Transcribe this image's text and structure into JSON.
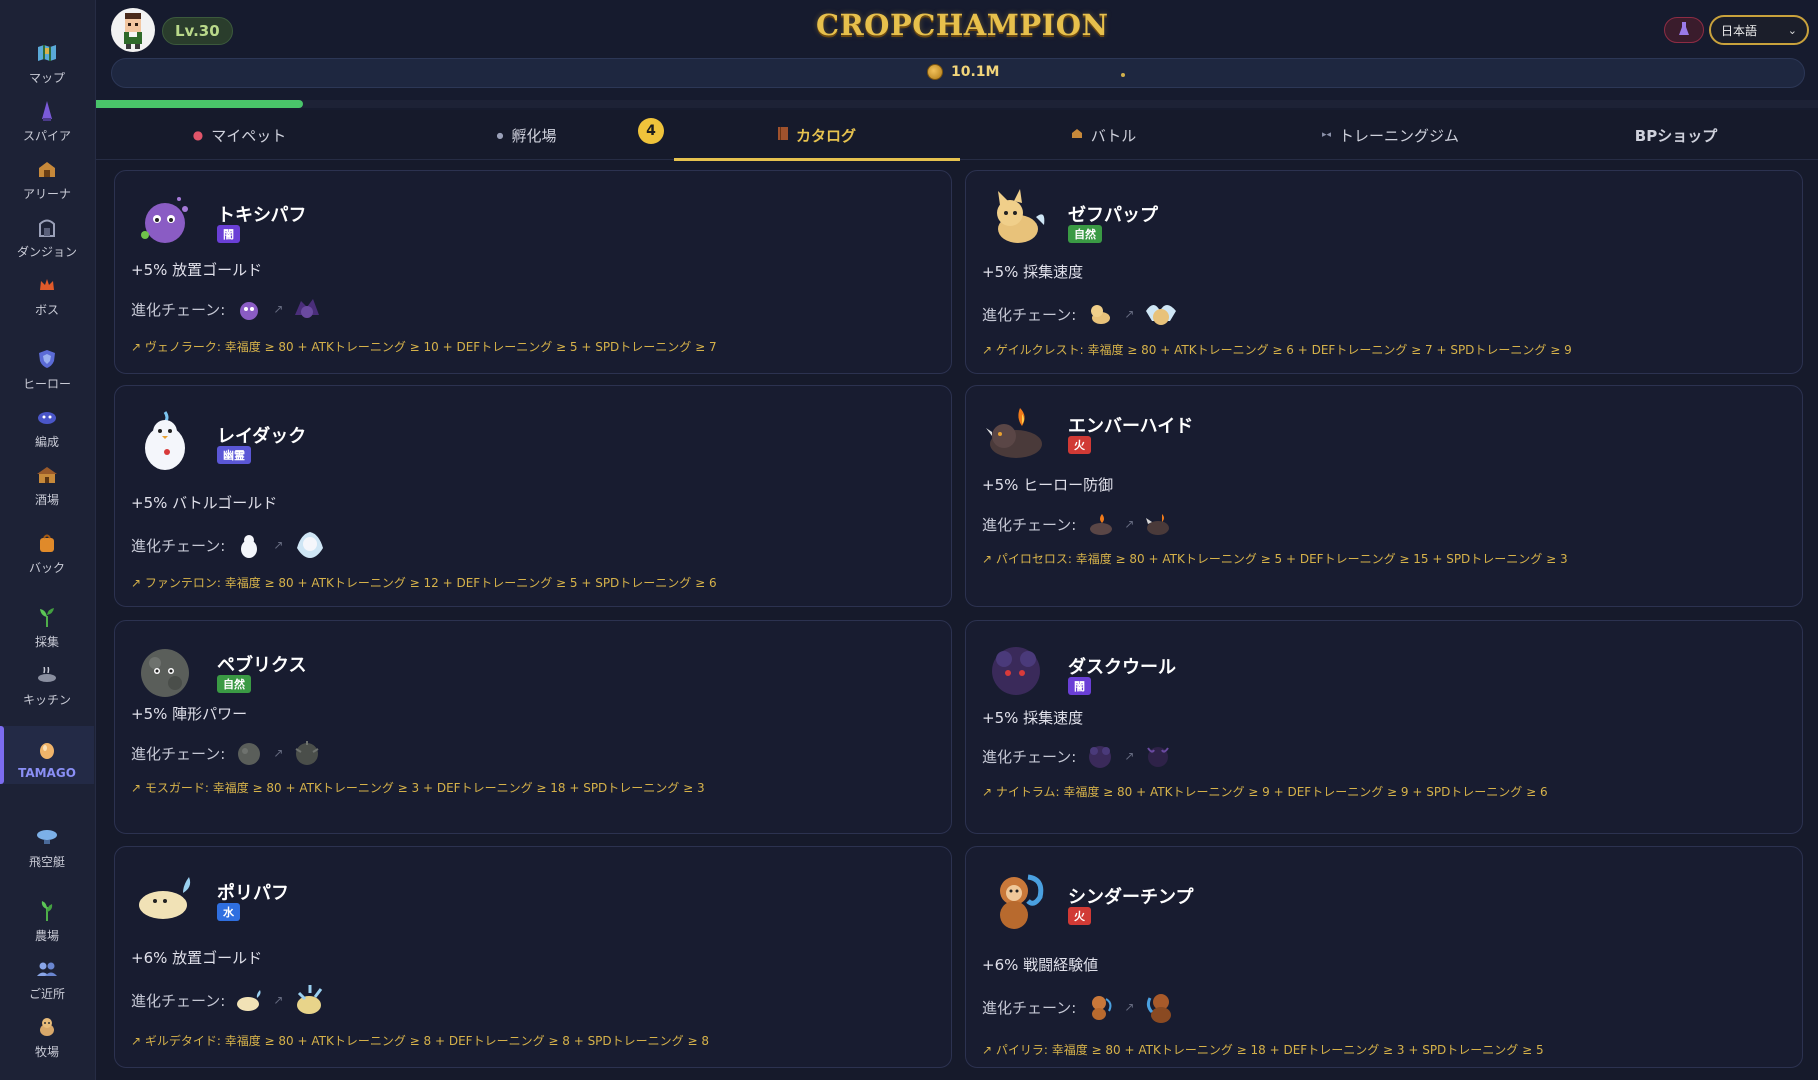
{
  "sidebar": {
    "items": [
      {
        "label": "マップ",
        "icon": "map-icon"
      },
      {
        "label": "スパイア",
        "icon": "spire-icon"
      },
      {
        "label": "アリーナ",
        "icon": "arena-icon"
      },
      {
        "label": "ダンジョン",
        "icon": "dungeon-icon"
      },
      {
        "label": "ボス",
        "icon": "boss-icon"
      },
      {
        "label": "ヒーロー",
        "icon": "hero-icon"
      },
      {
        "label": "編成",
        "icon": "formation-icon"
      },
      {
        "label": "酒場",
        "icon": "tavern-icon"
      },
      {
        "label": "バック",
        "icon": "bag-icon"
      },
      {
        "label": "採集",
        "icon": "sprout-icon"
      },
      {
        "label": "キッチン",
        "icon": "kitchen-icon"
      },
      {
        "label": "TAMAGO",
        "icon": "egg-icon"
      },
      {
        "label": "飛空艇",
        "icon": "airship-icon"
      },
      {
        "label": "農場",
        "icon": "farm-icon"
      },
      {
        "label": "ご近所",
        "icon": "neighbors-icon"
      },
      {
        "label": "牧場",
        "icon": "ranch-icon"
      }
    ],
    "active_label": "TAMAGO"
  },
  "header": {
    "level": "Lv.30",
    "logo": "CROPCHAMPION",
    "gold": "10.1M",
    "language": "日本語",
    "xp_progress_percent": 12
  },
  "tabs": {
    "items": [
      {
        "label": "マイペット",
        "icon": "paw-icon"
      },
      {
        "label": "孵化場",
        "icon": "egg-small-icon"
      },
      {
        "label": "カタログ",
        "icon": "book-icon"
      },
      {
        "label": "バトル",
        "icon": "arena-small-icon"
      },
      {
        "label": "トレーニングジム",
        "icon": "dumbbell-icon"
      },
      {
        "label": "BPショップ",
        "icon": ""
      }
    ],
    "active": "カタログ",
    "hatchery_badge": "4"
  },
  "labels": {
    "chain": "進化チェーン:"
  },
  "colors": {
    "gold_accent": "#e6c24f",
    "dark": "#6a3fd6",
    "nature": "#3a9a44",
    "ghost": "#5b57d6",
    "fire": "#d13a35",
    "water": "#2f6fe0"
  },
  "pets": [
    {
      "name": "トキシパフ",
      "element": "闇",
      "element_type": "dark",
      "bonus": "+5% 放置ゴールド",
      "requirement": "↗ ヴェノラーク: 幸福度 ≥ 80 + ATKトレーニング ≥ 10 + DEFトレーニング ≥ 5 + SPDトレーニング ≥ 7"
    },
    {
      "name": "ゼフパップ",
      "element": "自然",
      "element_type": "nature",
      "bonus": "+5% 採集速度",
      "requirement": "↗ ゲイルクレスト: 幸福度 ≥ 80 + ATKトレーニング ≥ 6 + DEFトレーニング ≥ 7 + SPDトレーニング ≥ 9"
    },
    {
      "name": "レイダック",
      "element": "幽霊",
      "element_type": "ghost",
      "bonus": "+5% バトルゴールド",
      "requirement": "↗ ファンテロン: 幸福度 ≥ 80 + ATKトレーニング ≥ 12 + DEFトレーニング ≥ 5 + SPDトレーニング ≥ 6"
    },
    {
      "name": "エンバーハイド",
      "element": "火",
      "element_type": "fire",
      "bonus": "+5% ヒーロー防御",
      "requirement": "↗ パイロセロス: 幸福度 ≥ 80 + ATKトレーニング ≥ 5 + DEFトレーニング ≥ 15 + SPDトレーニング ≥ 3"
    },
    {
      "name": "ペブリクス",
      "element": "自然",
      "element_type": "nature",
      "bonus": "+5% 陣形パワー",
      "requirement": "↗ モスガード: 幸福度 ≥ 80 + ATKトレーニング ≥ 3 + DEFトレーニング ≥ 18 + SPDトレーニング ≥ 3"
    },
    {
      "name": "ダスクウール",
      "element": "闇",
      "element_type": "dark",
      "bonus": "+5% 採集速度",
      "requirement": "↗ ナイトラム: 幸福度 ≥ 80 + ATKトレーニング ≥ 9 + DEFトレーニング ≥ 9 + SPDトレーニング ≥ 6"
    },
    {
      "name": "ポリパフ",
      "element": "水",
      "element_type": "water",
      "bonus": "+6% 放置ゴールド",
      "requirement": "↗ ギルデタイド: 幸福度 ≥ 80 + ATKトレーニング ≥ 8 + DEFトレーニング ≥ 8 + SPDトレーニング ≥ 8"
    },
    {
      "name": "シンダーチンプ",
      "element": "火",
      "element_type": "fire",
      "bonus": "+6% 戦闘経験値",
      "requirement": "↗ パイリラ: 幸福度 ≥ 80 + ATKトレーニング ≥ 18 + DEFトレーニング ≥ 3 + SPDトレーニング ≥ 5"
    }
  ]
}
